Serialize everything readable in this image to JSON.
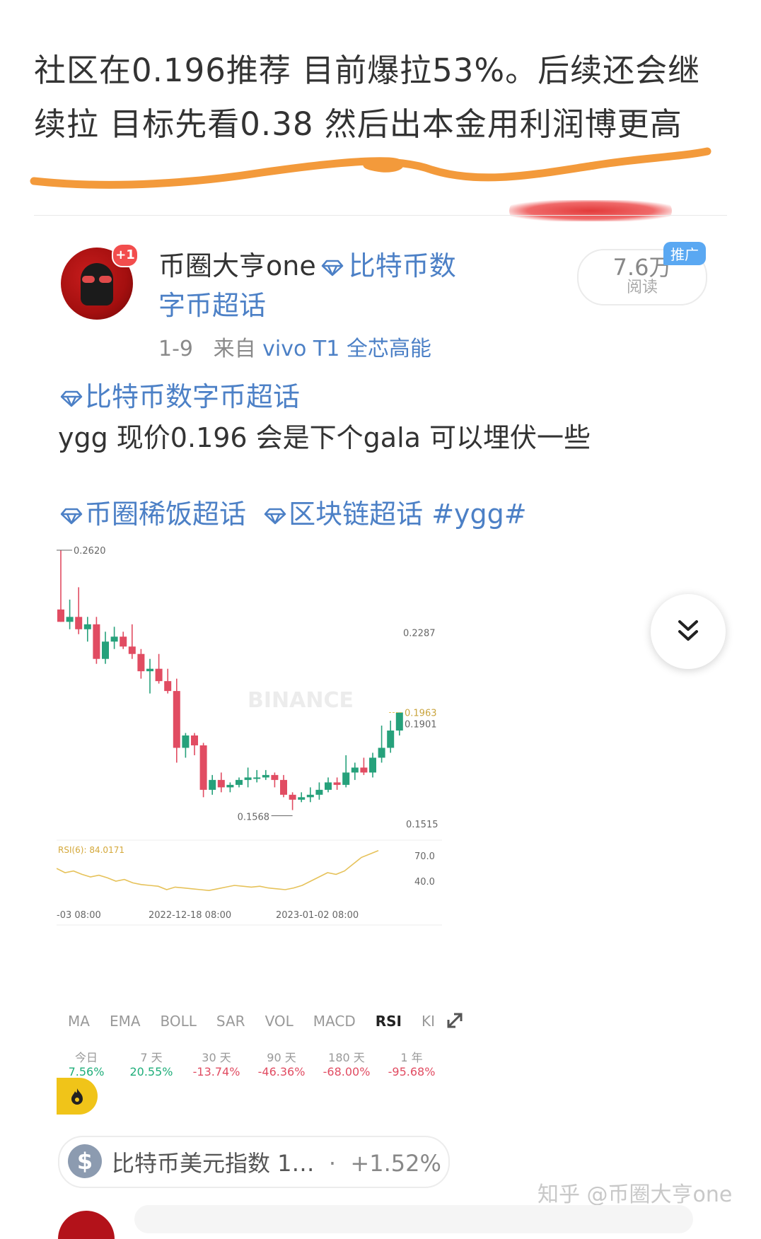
{
  "headline": {
    "line1": "社区在0.196推荐 目前爆拉53%。后续还会继",
    "line2": "续拉 目标先看0.38 然后出本金用利润博更高"
  },
  "post": {
    "author": "币圈大亨one",
    "topic": "比特币数字币超话",
    "topic_wrap_1": "比特币数",
    "topic_wrap_2": "字币超话",
    "badge": "+1",
    "date": "1-9",
    "source_prefix": "来自",
    "source": "vivo T1 全芯高能",
    "reads_num": "7.6万",
    "reads_label": "阅读",
    "promo": "推广",
    "tag_line": "比特币数字币超话",
    "body": "ygg  现价0.196  会是下个gala  可以埋伏一些",
    "tag_a": "币圈稀饭超话",
    "tag_b": "区块链超话 #ygg#"
  },
  "chart_data": {
    "type": "candlestick",
    "watermark": "BINANCE",
    "price_labels": {
      "high": "0.2620",
      "mid": "0.2287",
      "current": "0.1963",
      "below_current": "0.1901",
      "low": "0.1568",
      "bottom": "0.1515"
    },
    "x_ticks": [
      "-03 08:00",
      "2022-12-18 08:00",
      "2023-01-02 08:00"
    ],
    "ylim": [
      0.1515,
      0.262
    ],
    "candles": [
      {
        "o": 0.238,
        "h": 0.262,
        "l": 0.233,
        "c": 0.233
      },
      {
        "o": 0.233,
        "h": 0.242,
        "l": 0.23,
        "c": 0.235
      },
      {
        "o": 0.235,
        "h": 0.247,
        "l": 0.228,
        "c": 0.23
      },
      {
        "o": 0.23,
        "h": 0.235,
        "l": 0.225,
        "c": 0.232
      },
      {
        "o": 0.232,
        "h": 0.235,
        "l": 0.216,
        "c": 0.218
      },
      {
        "o": 0.218,
        "h": 0.229,
        "l": 0.216,
        "c": 0.225
      },
      {
        "o": 0.225,
        "h": 0.231,
        "l": 0.222,
        "c": 0.227
      },
      {
        "o": 0.227,
        "h": 0.229,
        "l": 0.222,
        "c": 0.223
      },
      {
        "o": 0.223,
        "h": 0.232,
        "l": 0.218,
        "c": 0.22
      },
      {
        "o": 0.22,
        "h": 0.222,
        "l": 0.21,
        "c": 0.213
      },
      {
        "o": 0.213,
        "h": 0.218,
        "l": 0.204,
        "c": 0.214
      },
      {
        "o": 0.214,
        "h": 0.22,
        "l": 0.208,
        "c": 0.209
      },
      {
        "o": 0.209,
        "h": 0.214,
        "l": 0.204,
        "c": 0.205
      },
      {
        "o": 0.205,
        "h": 0.21,
        "l": 0.176,
        "c": 0.182
      },
      {
        "o": 0.182,
        "h": 0.188,
        "l": 0.178,
        "c": 0.187
      },
      {
        "o": 0.187,
        "h": 0.188,
        "l": 0.179,
        "c": 0.183
      },
      {
        "o": 0.183,
        "h": 0.184,
        "l": 0.162,
        "c": 0.165
      },
      {
        "o": 0.165,
        "h": 0.171,
        "l": 0.163,
        "c": 0.169
      },
      {
        "o": 0.169,
        "h": 0.172,
        "l": 0.164,
        "c": 0.166
      },
      {
        "o": 0.166,
        "h": 0.168,
        "l": 0.164,
        "c": 0.167
      },
      {
        "o": 0.167,
        "h": 0.17,
        "l": 0.166,
        "c": 0.169
      },
      {
        "o": 0.169,
        "h": 0.174,
        "l": 0.166,
        "c": 0.17
      },
      {
        "o": 0.17,
        "h": 0.173,
        "l": 0.168,
        "c": 0.17
      },
      {
        "o": 0.17,
        "h": 0.173,
        "l": 0.169,
        "c": 0.171
      },
      {
        "o": 0.171,
        "h": 0.172,
        "l": 0.166,
        "c": 0.169
      },
      {
        "o": 0.169,
        "h": 0.171,
        "l": 0.162,
        "c": 0.163
      },
      {
        "o": 0.163,
        "h": 0.164,
        "l": 0.1568,
        "c": 0.161
      },
      {
        "o": 0.161,
        "h": 0.164,
        "l": 0.16,
        "c": 0.162
      },
      {
        "o": 0.162,
        "h": 0.166,
        "l": 0.16,
        "c": 0.163
      },
      {
        "o": 0.163,
        "h": 0.168,
        "l": 0.161,
        "c": 0.165
      },
      {
        "o": 0.165,
        "h": 0.17,
        "l": 0.164,
        "c": 0.168
      },
      {
        "o": 0.168,
        "h": 0.17,
        "l": 0.165,
        "c": 0.167
      },
      {
        "o": 0.167,
        "h": 0.179,
        "l": 0.166,
        "c": 0.172
      },
      {
        "o": 0.172,
        "h": 0.176,
        "l": 0.169,
        "c": 0.174
      },
      {
        "o": 0.174,
        "h": 0.178,
        "l": 0.171,
        "c": 0.172
      },
      {
        "o": 0.172,
        "h": 0.18,
        "l": 0.17,
        "c": 0.178
      },
      {
        "o": 0.178,
        "h": 0.191,
        "l": 0.176,
        "c": 0.182
      },
      {
        "o": 0.182,
        "h": 0.193,
        "l": 0.18,
        "c": 0.189
      },
      {
        "o": 0.189,
        "h": 0.194,
        "l": 0.187,
        "c": 0.1963
      }
    ],
    "rsi": {
      "label": "RSI(6): 84.0171",
      "levels": [
        "70.0",
        "40.0"
      ],
      "values": [
        55,
        50,
        52,
        48,
        45,
        47,
        44,
        40,
        42,
        38,
        36,
        35,
        34,
        30,
        33,
        32,
        31,
        30,
        29,
        31,
        33,
        35,
        34,
        33,
        34,
        32,
        31,
        30,
        32,
        35,
        40,
        45,
        50,
        48,
        52,
        60,
        68,
        72,
        76
      ]
    }
  },
  "indicators": {
    "tabs": [
      "MA",
      "EMA",
      "BOLL",
      "SAR",
      "VOL",
      "MACD",
      "RSI",
      "KI"
    ],
    "active": "RSI"
  },
  "performance": [
    {
      "label": "今日",
      "value": "7.56%",
      "sign": "pos"
    },
    {
      "label": "7 天",
      "value": "20.55%",
      "sign": "pos"
    },
    {
      "label": "30 天",
      "value": "-13.74%",
      "sign": "neg"
    },
    {
      "label": "90 天",
      "value": "-46.36%",
      "sign": "neg"
    },
    {
      "label": "180 天",
      "value": "-68.00%",
      "sign": "neg"
    },
    {
      "label": "1 年",
      "value": "-95.68%",
      "sign": "neg"
    }
  ],
  "ticker": {
    "name": "比特币美元指数 1…",
    "sep": "·",
    "change": "+1.52%"
  },
  "watermark": "知乎 @币圈大亨one",
  "colors": {
    "up": "#26a17b",
    "down": "#e14c62",
    "orange": "#f39a3b",
    "topic": "#4c80c6",
    "rsi": "#e6c25a"
  }
}
